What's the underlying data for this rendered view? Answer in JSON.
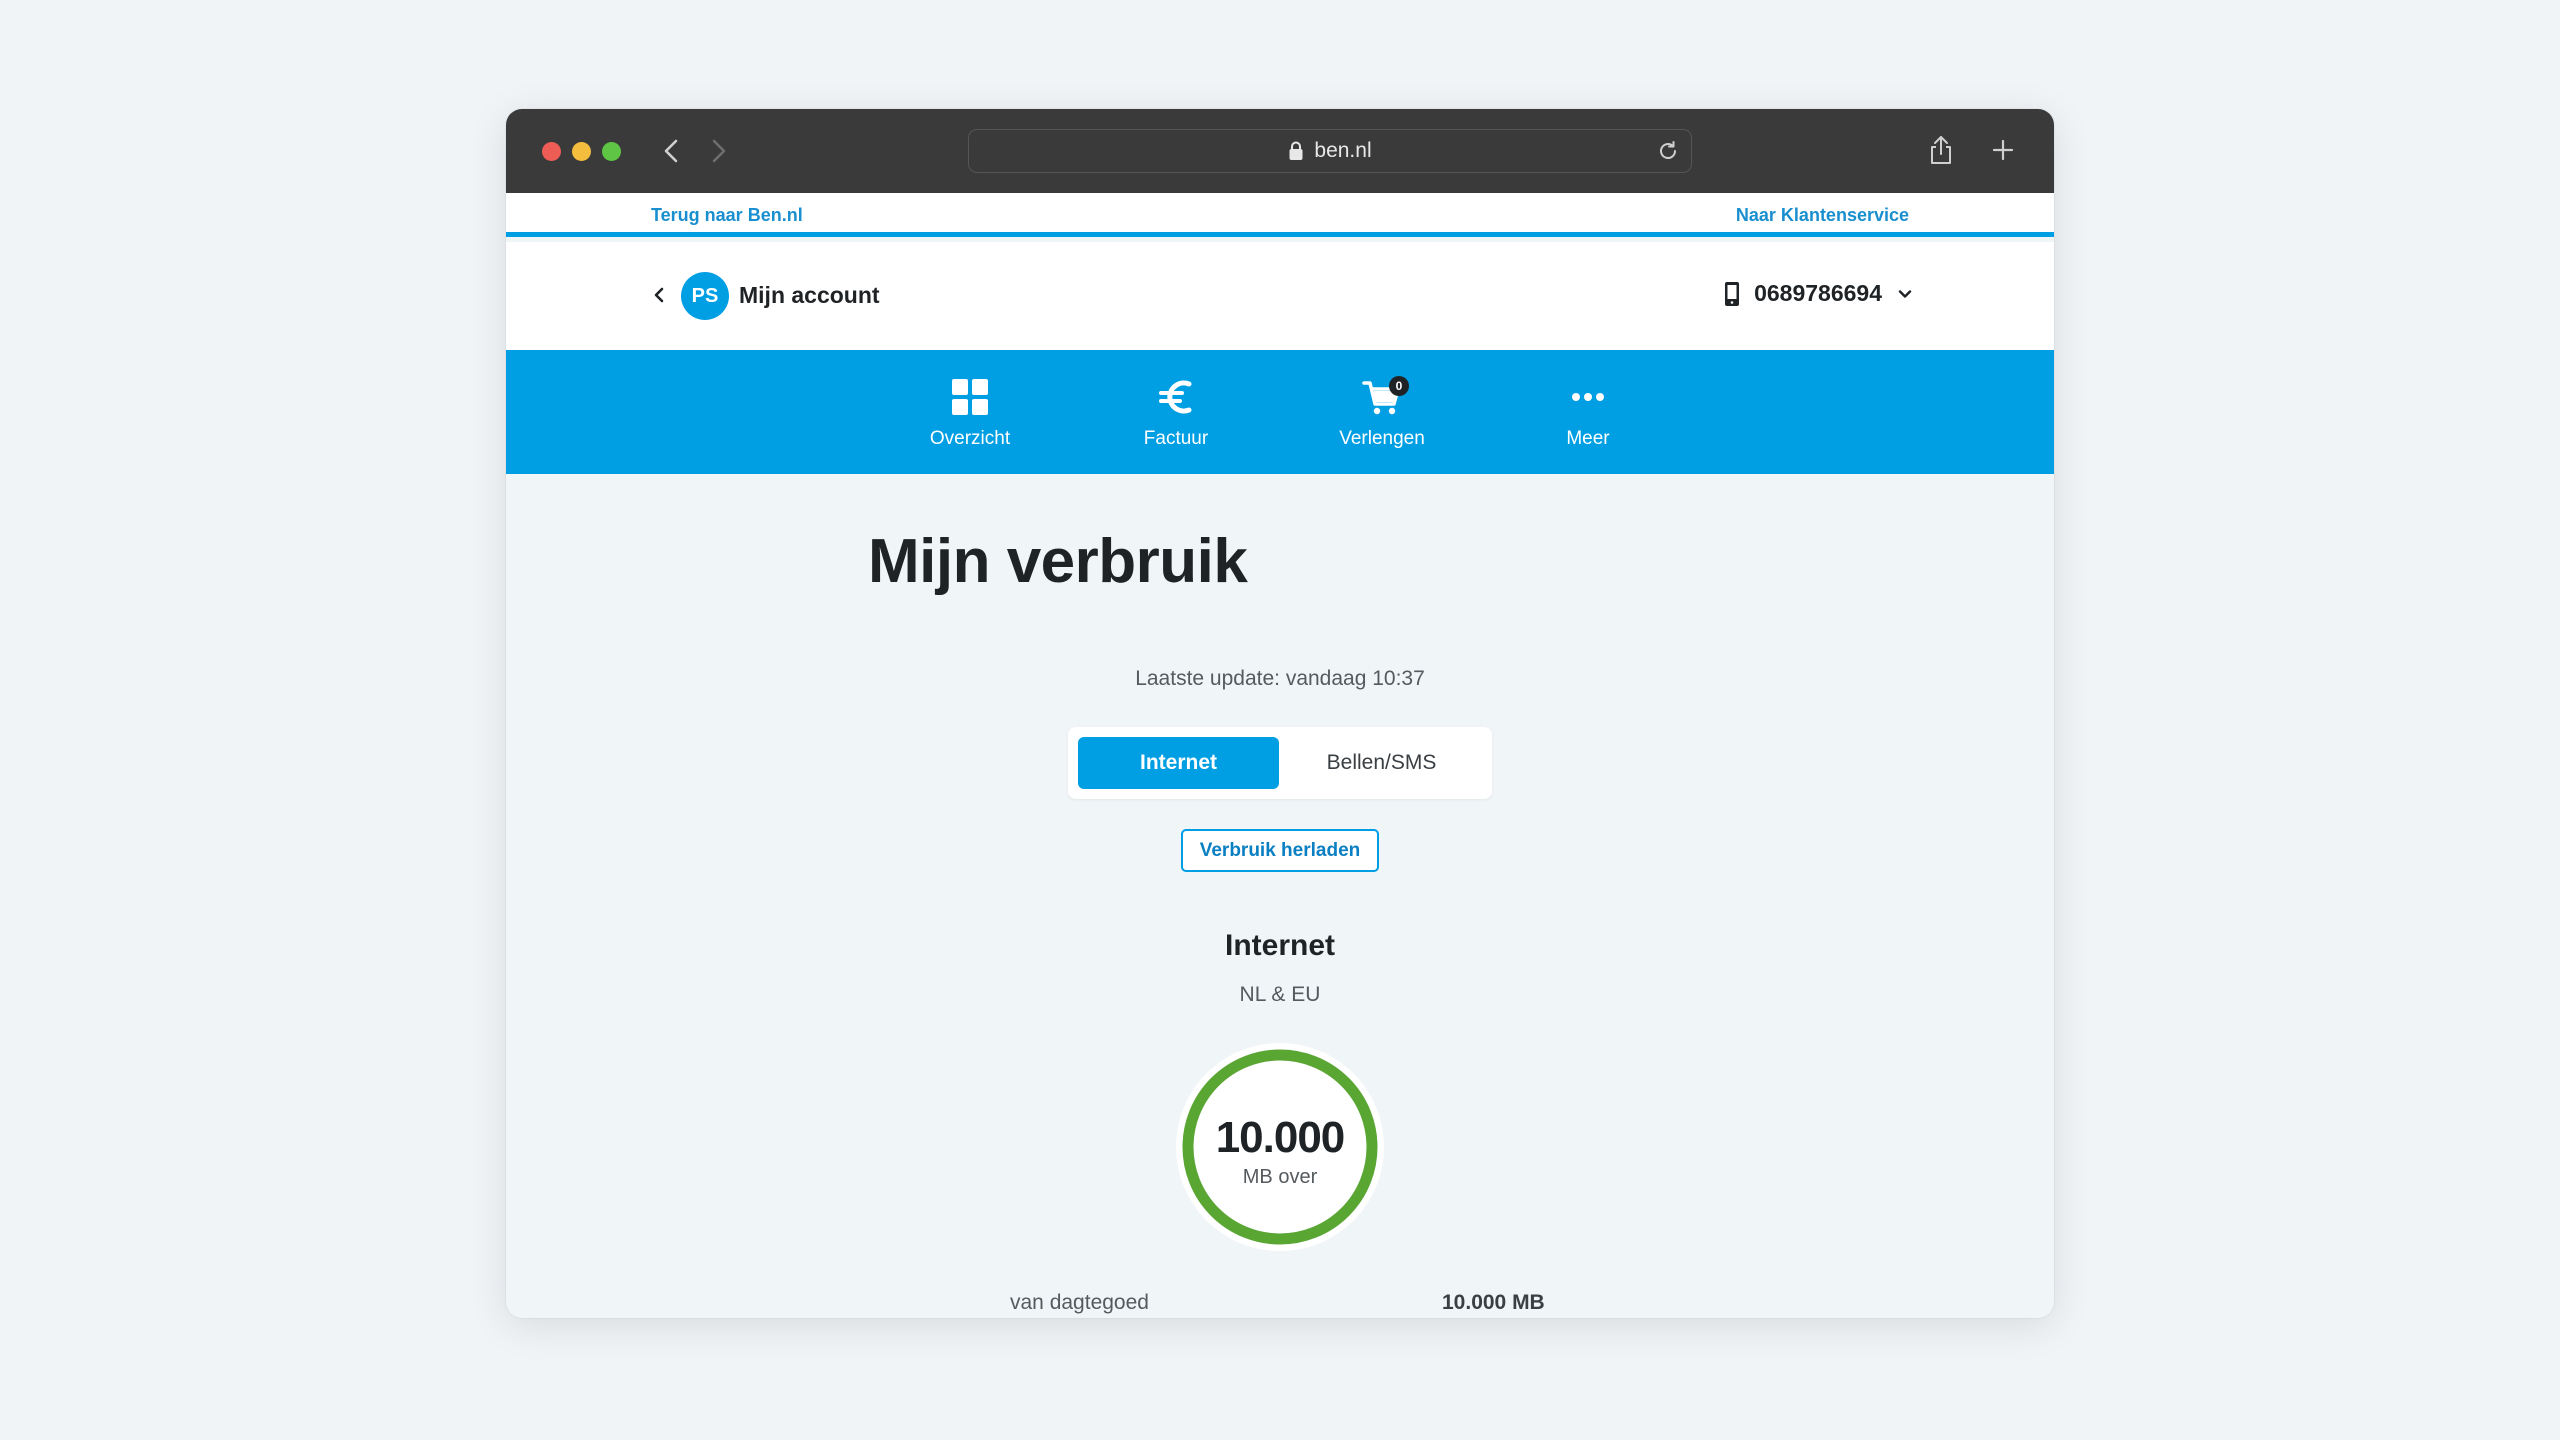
{
  "browser": {
    "url": "ben.nl"
  },
  "topbar": {
    "back_link": "Terug naar Ben.nl",
    "service_link": "Naar Klantenservice"
  },
  "account": {
    "initials": "PS",
    "title": "Mijn account",
    "phone_number": "0689786694"
  },
  "nav": {
    "items": [
      {
        "label": "Overzicht",
        "icon": "grid-icon"
      },
      {
        "label": "Factuur",
        "icon": "euro-icon"
      },
      {
        "label": "Verlengen",
        "icon": "cart-icon",
        "badge": "0"
      },
      {
        "label": "Meer",
        "icon": "more-dots-icon"
      }
    ]
  },
  "content": {
    "title": "Mijn verbruik",
    "last_update": "Laatste update: vandaag 10:37",
    "tabs": [
      {
        "label": "Internet",
        "active": true
      },
      {
        "label": "Bellen/SMS",
        "active": false
      }
    ],
    "reload_button": "Verbruik herladen",
    "section_title": "Internet",
    "section_subtitle": "NL & EU",
    "gauge": {
      "value": "10.000",
      "unit": "MB over",
      "fraction_remaining": 1.0,
      "color": "#5aa632"
    },
    "detail_row": {
      "label": "van dagtegoed",
      "value": "10.000 MB"
    }
  },
  "colors": {
    "brand": "#009fe3",
    "link": "#1a8fcf"
  }
}
